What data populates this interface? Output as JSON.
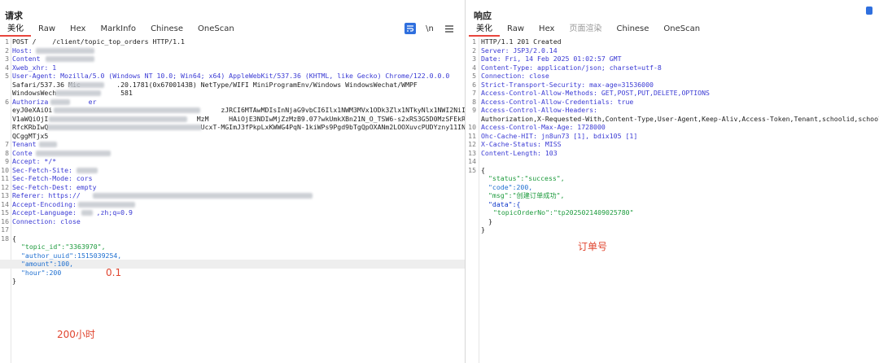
{
  "request": {
    "title": "请求",
    "tabs": [
      "美化",
      "Raw",
      "Hex",
      "MarkInfo",
      "Chinese",
      "OneScan"
    ],
    "active_tab": "美化",
    "tool_newline": "\\n",
    "lines": [
      "POST /    /client/topic_top_orders HTTP/1.1",
      "Host: ",
      "Content",
      "Xweb_xhr: 1",
      "User-Agent: Mozilla/5.0 (Windows NT 10.0; Win64; x64) AppleWebKit/537.36 (KHTML, like Gecko) Chrome/122.0.0.0",
      "Safari/537.36 Mic         .20.1781(0x6700143B) NetType/WIFI MiniProgramEnv/Windows WindowsWechat/WMPF",
      "WindowsWech                581",
      "Authoriza          er",
      "eyJ0eXAiOi                                          zJRCI6MTAwMDIsInNjaG9vbCI6Ilx1NWM3MVx1ODk3Zlx1NTkyNlx1NWI2NiIsIn",
      "V1aWQiOjI                                     MzM     HAiOjE3NDIwMjZzMzB9.07?wkUmkXBn21N_O_TSW6-s2xRS3G5D0MzSFEkR5bekt",
      "RfcKRbIwQ                                      UcxT-MGImJ3fPkpLxKWWG4PqN-1kiWPs9Pgd9bTgQpOXANm2LOOXuvcPUDYzny11IN",
      "QCggMTjx5",
      "Tenant",
      "Conte",
      "Accept: */*",
      "Sec-Fetch-Site:      ",
      "Sec-Fetch-Mode: cors",
      "Sec-Fetch-Dest: empty",
      "Referer: https://",
      "Accept-Encoding:",
      "Accept-Language:     ,zh;q=0.9",
      "Connection: close",
      "",
      "{",
      "\"topic_id\":\"3363970\",",
      "\"author_uuid\":1515039254,",
      "\"amount\":100,",
      "\"hour\":200",
      "}"
    ],
    "line_numbers": [
      "1",
      "2",
      "3",
      "4",
      "5",
      "",
      "",
      "6",
      "",
      "",
      "",
      "",
      "7",
      "8",
      "9",
      "10",
      "11",
      "12",
      "13",
      "14",
      "15",
      "16",
      "17",
      "18",
      "",
      "",
      "",
      "",
      ""
    ],
    "annotations": {
      "amount_note": "0.1",
      "hour_note": "200小时"
    }
  },
  "response": {
    "title": "响应",
    "tabs": [
      "美化",
      "Raw",
      "Hex",
      "页面渲染",
      "Chinese",
      "OneScan"
    ],
    "active_tab": "美化",
    "lines": [
      "HTTP/1.1 201 Created",
      "Server: JSP3/2.0.14",
      "Date: Fri, 14 Feb 2025 01:02:57 GMT",
      "Content-Type: application/json; charset=utf-8",
      "Connection: close",
      "Strict-Transport-Security: max-age=31536000",
      "Access-Control-Allow-Methods: GET,POST,PUT,DELETE,OPTIONS",
      "Access-Control-Allow-Credentials: true",
      "Access-Control-Allow-Headers:",
      "Authorization,X-Requested-With,Content-Type,User-Agent,Keep-Aliv,Access-Token,Tenant,schoolid,school",
      "Access-Control-Max-Age: 1728000",
      "Ohc-Cache-HIT: jn8un73 [1], bdix105 [1]",
      "X-Cache-Status: MISS",
      "Content-Length: 103",
      "",
      "{",
      "\"status\":\"success\",",
      "\"code\":200,",
      "\"msg\":\"创建订单成功\",",
      "\"data\":{",
      "\"topicOrderNo\":\"tp2025021409025780\"",
      "}",
      "}"
    ],
    "line_numbers": [
      "1",
      "2",
      "3",
      "4",
      "5",
      "6",
      "7",
      "8",
      "9",
      "",
      "10",
      "11",
      "12",
      "13",
      "14",
      "15",
      "",
      "",
      "",
      "",
      "",
      "",
      ""
    ],
    "annotations": {
      "order_note": "订单号"
    }
  },
  "colors": {
    "accent": "#e8453c",
    "key": "#3a3ad4",
    "json_key": "#0b34c9",
    "json_string": "#1c9a3c",
    "json_number": "#1e6fd0",
    "annotation": "#e0452f",
    "button_blue": "#2f6fde"
  }
}
